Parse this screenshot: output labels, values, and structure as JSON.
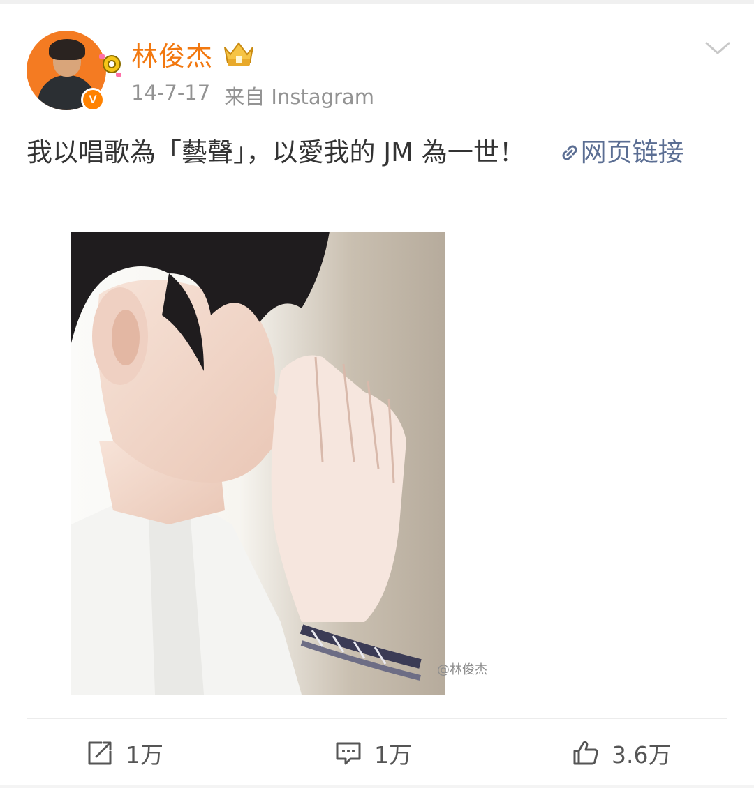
{
  "post": {
    "username": "林俊杰",
    "date": "14-7-17",
    "source": "来自 Instagram",
    "text": "我以唱歌為「藝聲」，以愛我的 JM 為一世！",
    "link_label": "网页链接",
    "image_watermark": "@林俊杰",
    "verified_mark": "V"
  },
  "actions": {
    "repost_count": "1万",
    "comment_count": "1万",
    "like_count": "3.6万"
  },
  "icons": {
    "menu": "chevron-down-icon",
    "repost": "repost-icon",
    "comment": "comment-icon",
    "like": "thumbs-up-icon",
    "link": "link-icon"
  },
  "colors": {
    "username": "#f2780f",
    "link": "#5b6e93",
    "meta": "#939393",
    "verified": "#ff8200",
    "text": "#333333"
  }
}
